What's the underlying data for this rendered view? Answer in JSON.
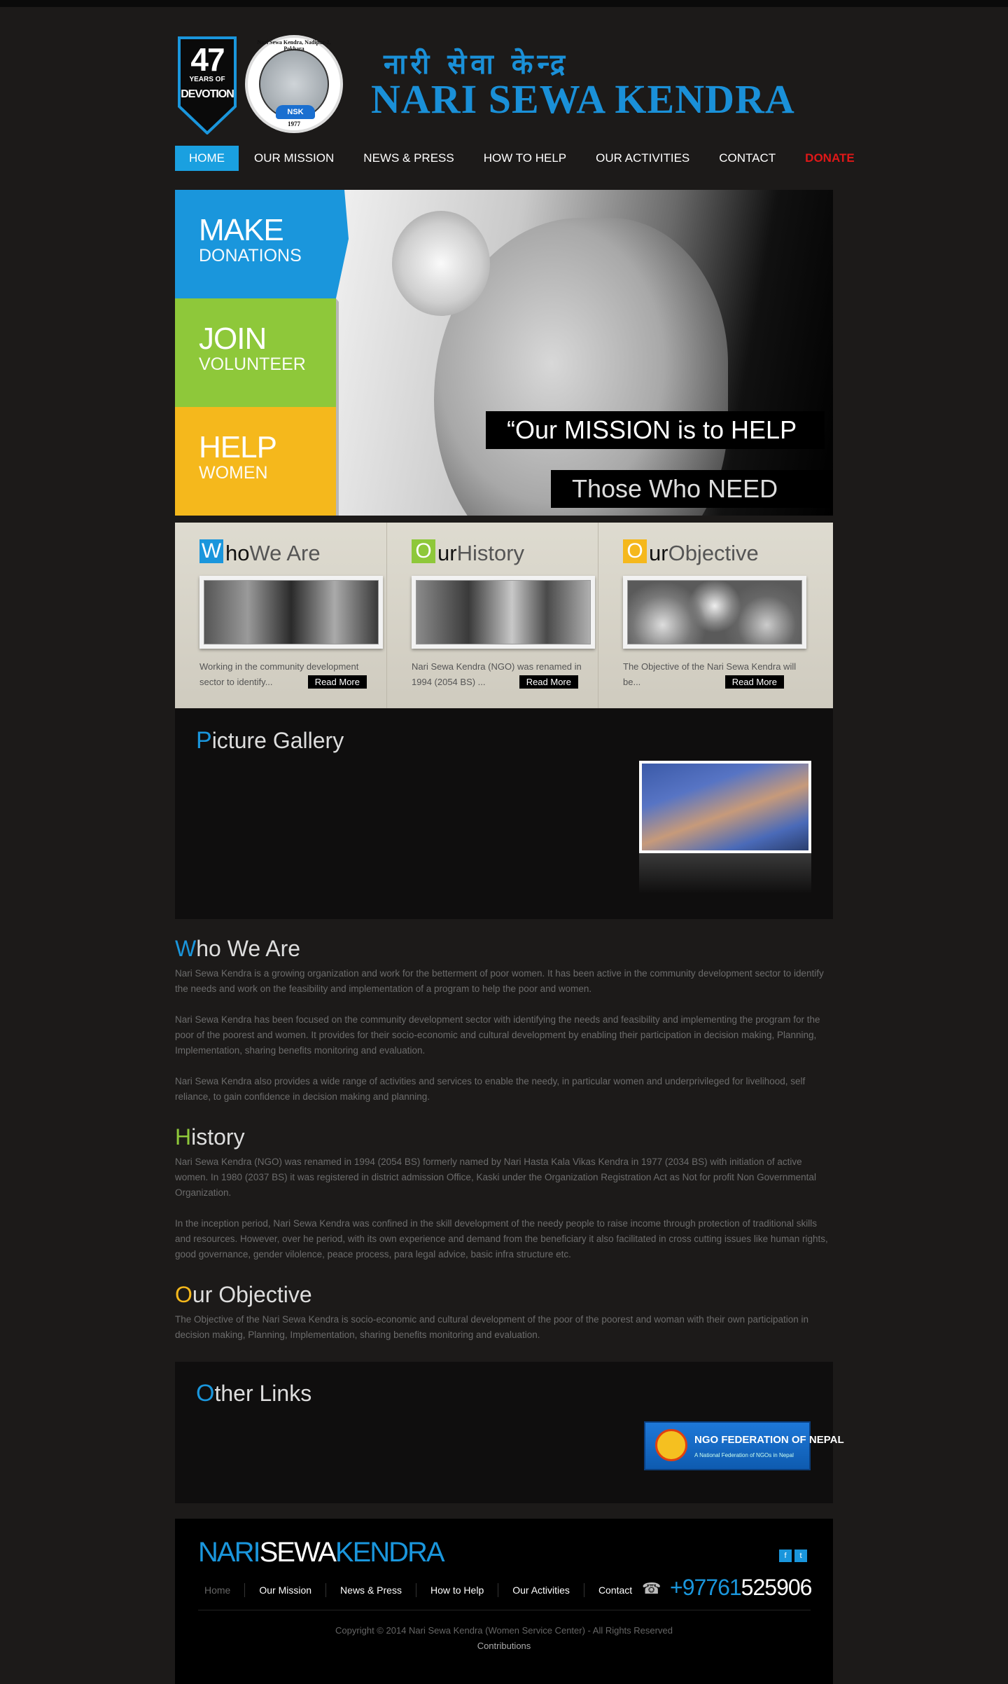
{
  "header": {
    "badge_number": "47",
    "badge_line1": "YEARS OF",
    "badge_line2": "DEVOTION",
    "seal_top": "Nari Sewa Kendra, Nadipur-2, Pokhara",
    "seal_abbrev": "NSK",
    "seal_year": "1977",
    "nepali_title": "नारी सेवा केन्द्र",
    "title": "NARI SEWA KENDRA"
  },
  "nav": {
    "items": [
      "HOME",
      "OUR MISSION",
      "NEWS & PRESS",
      "HOW TO HELP",
      "OUR ACTIVITIES",
      "CONTACT",
      "DONATE"
    ]
  },
  "hero": {
    "tiles": [
      {
        "big": "MAKE",
        "small": "DONATIONS"
      },
      {
        "big": "JOIN",
        "small": "VOLUNTEER"
      },
      {
        "big": "HELP",
        "small": "WOMEN"
      }
    ],
    "quote_line1": "“Our MISSION is to HELP",
    "quote_line2": "Those Who NEED It”"
  },
  "columns": [
    {
      "cap": "W",
      "bold": "ho",
      "rest": "We Are",
      "text": "Working in the community development sector to identify...",
      "more": "Read More"
    },
    {
      "cap": "O",
      "bold": "ur",
      "rest": "History",
      "text": "Nari Sewa Kendra (NGO) was renamed in 1994 (2054 BS) ...",
      "more": "Read More"
    },
    {
      "cap": "O",
      "bold": "ur",
      "rest": "Objective",
      "text": "The Objective of the Nari Sewa Kendra will be...",
      "more": "Read More"
    }
  ],
  "gallery": {
    "cap": "P",
    "rest": "icture Gallery"
  },
  "who": {
    "cap": "W",
    "rest": "ho We Are",
    "p1": "Nari Sewa Kendra is a growing organization and work for the betterment of poor women. It has been active in the community development sector to identify the needs and work on the feasibility and implementation of a program to help the poor and women.",
    "p2": "Nari Sewa Kendra has been focused on the community development sector with identifying the needs and feasibility and implementing the program for the poor of the poorest and women. It provides for their socio-economic and cultural development by enabling their participation in decision making, Planning, Implementation, sharing benefits monitoring and evaluation.",
    "p3": "Nari Sewa Kendra also provides a wide range of activities and services to enable the needy, in particular women and underprivileged for livelihood, self reliance, to gain confidence in decision making and planning."
  },
  "history": {
    "cap": "H",
    "rest": "istory",
    "p1": "Nari Sewa Kendra (NGO) was renamed in 1994 (2054 BS) formerly named by Nari Hasta Kala Vikas Kendra in 1977 (2034 BS) with initiation of active women. In 1980 (2037 BS) it was registered in district admission Office, Kaski under the Organization Registration Act as Not for profit Non Governmental Organization.",
    "p2": "In the inception period, Nari Sewa Kendra was confined in the skill development of the needy people to raise income through protection of traditional skills and resources. However, over he period, with its own experience and demand from the beneficiary it also facilitated in cross cutting issues like human rights, good governance, gender vilolence, peace process, para legal advice, basic infra structure etc."
  },
  "objective": {
    "cap": "O",
    "rest": "ur Objective",
    "p1": "The Objective of the Nari Sewa Kendra is socio-economic and cultural development of the poor of the poorest and woman with their own participation in decision making, Planning, Implementation, sharing benefits monitoring and evaluation."
  },
  "links": {
    "cap": "O",
    "rest": "ther Links",
    "ngo_name": "NGO FEDERATION OF NEPAL",
    "ngo_sub": "A National Federation of NGOs in Nepal"
  },
  "footer": {
    "brand_a": "NARI",
    "brand_b": "SEWA",
    "brand_c": "KENDRA",
    "nav": [
      "Home",
      "Our Mission",
      "News & Press",
      "How to Help",
      "Our Activities",
      "Contact"
    ],
    "phone_a": "+97761",
    "phone_b": "525906",
    "copyright": "Copyright © 2014 Nari Sewa Kendra (Women Service Center) - All Rights Reserved",
    "contributions": "Contributions"
  },
  "colors": {
    "blue": "#1a96dc",
    "green": "#8ec83a",
    "yellow": "#f5b81c",
    "donate": "#e01818"
  },
  "icons": [
    "facebook-icon",
    "twitter-icon",
    "phone-icon"
  ]
}
